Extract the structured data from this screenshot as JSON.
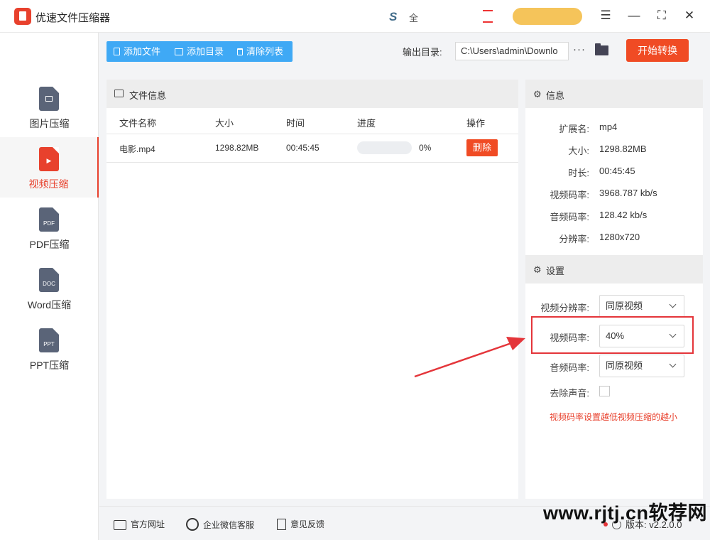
{
  "app": {
    "title": "优速文件压缩器"
  },
  "titlebar": {
    "glyph_s": "S",
    "glyph_small": "全",
    "menu": "☰",
    "minimize": "—",
    "maximize": "⛶",
    "close": "✕"
  },
  "sidebar": {
    "items": [
      {
        "label": "图片压缩",
        "icon": "image-doc-icon",
        "tag": "",
        "active": false
      },
      {
        "label": "视频压缩",
        "icon": "video-doc-icon",
        "tag": "▶",
        "active": true
      },
      {
        "label": "PDF压缩",
        "icon": "pdf-doc-icon",
        "tag": "PDF",
        "active": false
      },
      {
        "label": "Word压缩",
        "icon": "doc-doc-icon",
        "tag": "DOC",
        "active": false
      },
      {
        "label": "PPT压缩",
        "icon": "ppt-doc-icon",
        "tag": "PPT",
        "active": false
      }
    ]
  },
  "toolbar": {
    "add_file": "添加文件",
    "add_folder": "添加目录",
    "clear_list": "清除列表"
  },
  "output": {
    "label": "输出目录:",
    "path": "C:\\Users\\admin\\Downlo",
    "more": "···",
    "start": "开始转换"
  },
  "file_panel": {
    "title": "文件信息",
    "columns": [
      "文件名称",
      "大小",
      "时间",
      "进度",
      "操作"
    ],
    "rows": [
      {
        "name": "电影.mp4",
        "size": "1298.82MB",
        "time": "00:45:45",
        "progress_text": "0%",
        "progress": 0,
        "action": "删除"
      }
    ]
  },
  "info": {
    "title": "信息",
    "fields": [
      {
        "label": "扩展名:",
        "value": "mp4"
      },
      {
        "label": "大小:",
        "value": "1298.82MB"
      },
      {
        "label": "时长:",
        "value": "00:45:45"
      },
      {
        "label": "视频码率:",
        "value": "3968.787 kb/s"
      },
      {
        "label": "音频码率:",
        "value": "128.42 kb/s"
      },
      {
        "label": "分辨率:",
        "value": "1280x720"
      }
    ]
  },
  "settings": {
    "title": "设置",
    "video_resolution": {
      "label": "视频分辨率:",
      "value": "同原视频"
    },
    "video_bitrate": {
      "label": "视频码率:",
      "value": "40%"
    },
    "audio_bitrate": {
      "label": "音频码率:",
      "value": "同原视频"
    },
    "mute": {
      "label": "去除声音:",
      "checked": false
    },
    "hint": "视频码率设置越低视频压缩的越小"
  },
  "footer": {
    "website": "官方网址",
    "wechat": "企业微信客服",
    "feedback": "意见反馈",
    "version": "版本: v2.2.0.0"
  },
  "watermark": "www.rjtj.cn软荐网",
  "colors": {
    "accent": "#e8412d",
    "toolbar_blue": "#3fa9f5",
    "highlight_red": "#e4353a"
  }
}
